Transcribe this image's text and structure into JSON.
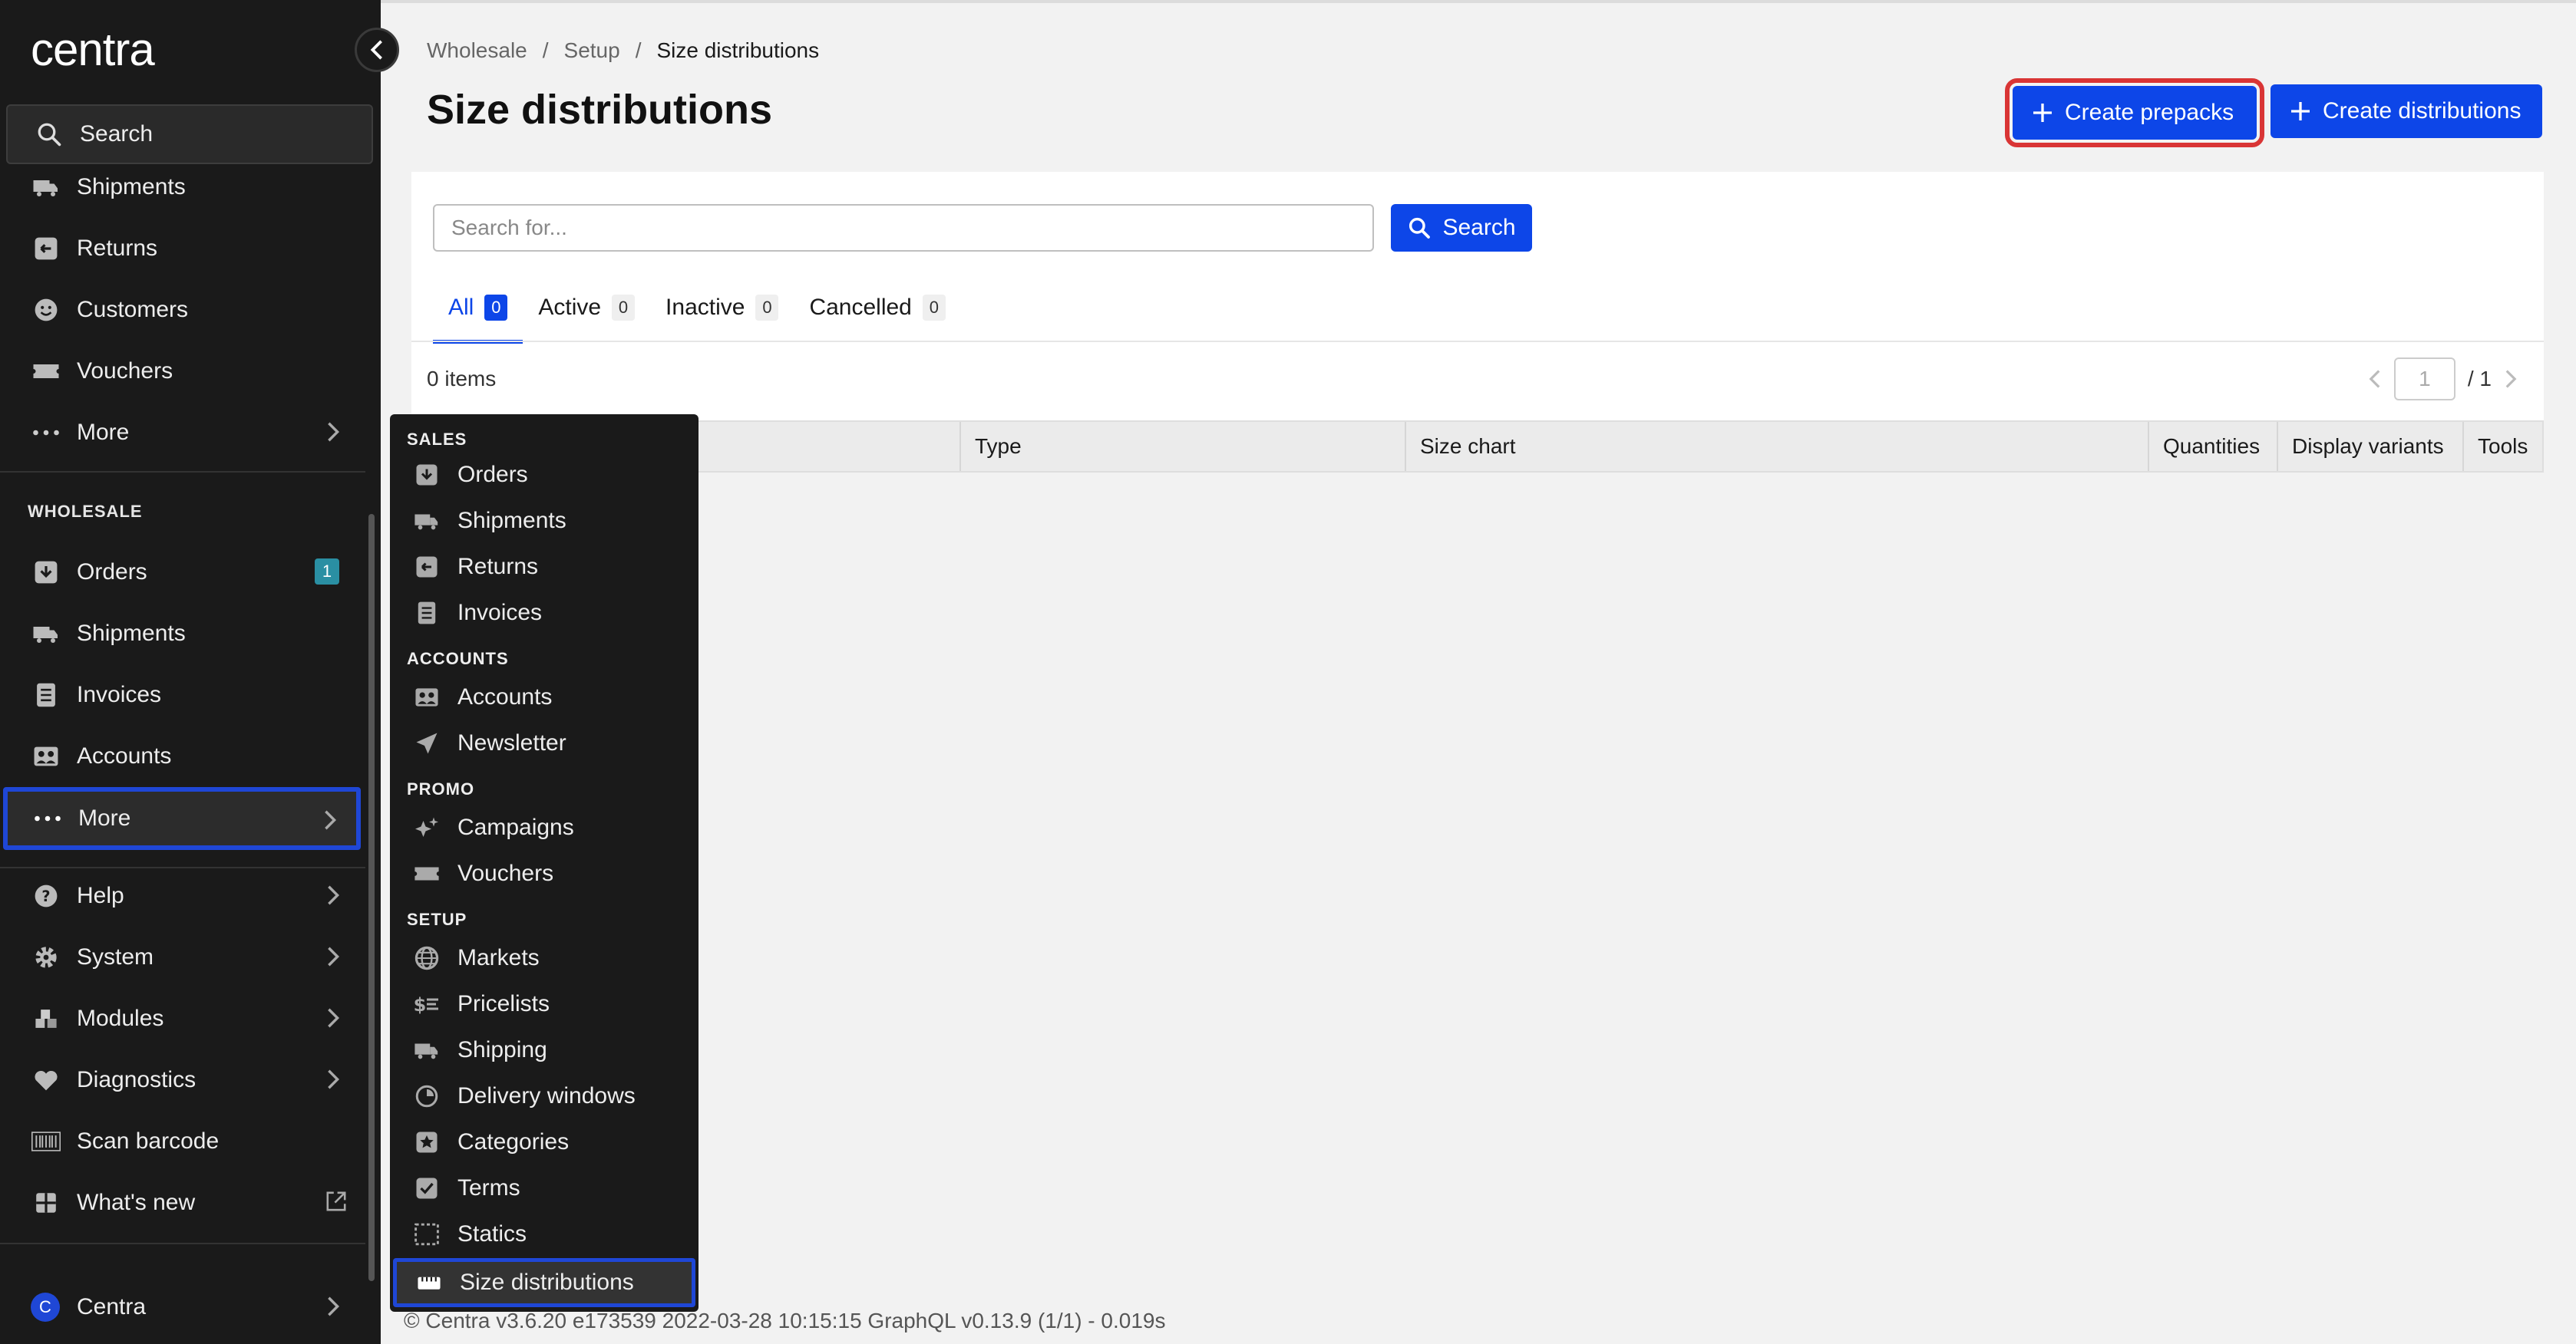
{
  "sidebar": {
    "logo": "centra",
    "search_label": "Search",
    "top_items": [
      {
        "label": "Shipments",
        "icon": "truck-icon"
      },
      {
        "label": "Returns",
        "icon": "return-icon"
      },
      {
        "label": "Customers",
        "icon": "smiley-icon"
      },
      {
        "label": "Vouchers",
        "icon": "ticket-icon"
      },
      {
        "label": "More",
        "icon": "dots-icon"
      }
    ],
    "wholesale_heading": "WHOLESALE",
    "wholesale_items": [
      {
        "label": "Orders",
        "icon": "download-box-icon",
        "badge": "1"
      },
      {
        "label": "Shipments",
        "icon": "truck-icon"
      },
      {
        "label": "Invoices",
        "icon": "document-icon"
      },
      {
        "label": "Accounts",
        "icon": "contacts-icon"
      },
      {
        "label": "More",
        "icon": "dots-icon"
      }
    ],
    "bottom_items": [
      {
        "label": "Help",
        "icon": "help-icon"
      },
      {
        "label": "System",
        "icon": "gear-icon"
      },
      {
        "label": "Modules",
        "icon": "cubes-icon"
      },
      {
        "label": "Diagnostics",
        "icon": "heart-icon"
      },
      {
        "label": "Scan barcode",
        "icon": "barcode-icon"
      },
      {
        "label": "What's new",
        "icon": "gift-icon"
      }
    ],
    "user": {
      "initial": "C",
      "label": "Centra"
    }
  },
  "header": {
    "breadcrumb": [
      "Wholesale",
      "Setup",
      "Size distributions"
    ],
    "breadcrumb_sep": "/",
    "title": "Size distributions",
    "create_prepacks": "Create prepacks",
    "create_distributions": "Create distributions"
  },
  "search": {
    "placeholder": "Search for...",
    "button": "Search"
  },
  "tabs": [
    {
      "label": "All",
      "count": "0"
    },
    {
      "label": "Active",
      "count": "0"
    },
    {
      "label": "Inactive",
      "count": "0"
    },
    {
      "label": "Cancelled",
      "count": "0"
    }
  ],
  "list": {
    "items_count": "0 items",
    "page": "1",
    "page_total": "/ 1"
  },
  "table": {
    "columns": [
      "Type",
      "Size chart",
      "Quantities",
      "Display variants",
      "Tools"
    ]
  },
  "flyout": {
    "sections": [
      {
        "heading": "SALES",
        "items": [
          {
            "label": "Orders",
            "icon": "download-box-icon"
          },
          {
            "label": "Shipments",
            "icon": "truck-icon"
          },
          {
            "label": "Returns",
            "icon": "return-icon"
          },
          {
            "label": "Invoices",
            "icon": "document-icon"
          }
        ]
      },
      {
        "heading": "ACCOUNTS",
        "items": [
          {
            "label": "Accounts",
            "icon": "contacts-icon"
          },
          {
            "label": "Newsletter",
            "icon": "paper-plane-icon"
          }
        ]
      },
      {
        "heading": "PROMO",
        "items": [
          {
            "label": "Campaigns",
            "icon": "sparkle-icon"
          },
          {
            "label": "Vouchers",
            "icon": "ticket-icon"
          }
        ]
      },
      {
        "heading": "SETUP",
        "items": [
          {
            "label": "Markets",
            "icon": "globe-icon"
          },
          {
            "label": "Pricelists",
            "icon": "pricelist-icon"
          },
          {
            "label": "Shipping",
            "icon": "shipping-icon"
          },
          {
            "label": "Delivery windows",
            "icon": "clock-icon"
          },
          {
            "label": "Categories",
            "icon": "star-box-icon"
          },
          {
            "label": "Terms",
            "icon": "checkbox-icon"
          },
          {
            "label": "Statics",
            "icon": "dashed-box-icon"
          },
          {
            "label": "Size distributions",
            "icon": "ruler-icon"
          }
        ]
      }
    ]
  },
  "footer": "© Centra v3.6.20 e173539 2022-03-28 10:15:15 GraphQL v0.13.9 (1/1) - 0.019s",
  "colors": {
    "accent": "#0d46e8",
    "highlight": "#d93535",
    "sidebar_bg": "#1a1a1a",
    "badge": "#2a8fa3"
  }
}
